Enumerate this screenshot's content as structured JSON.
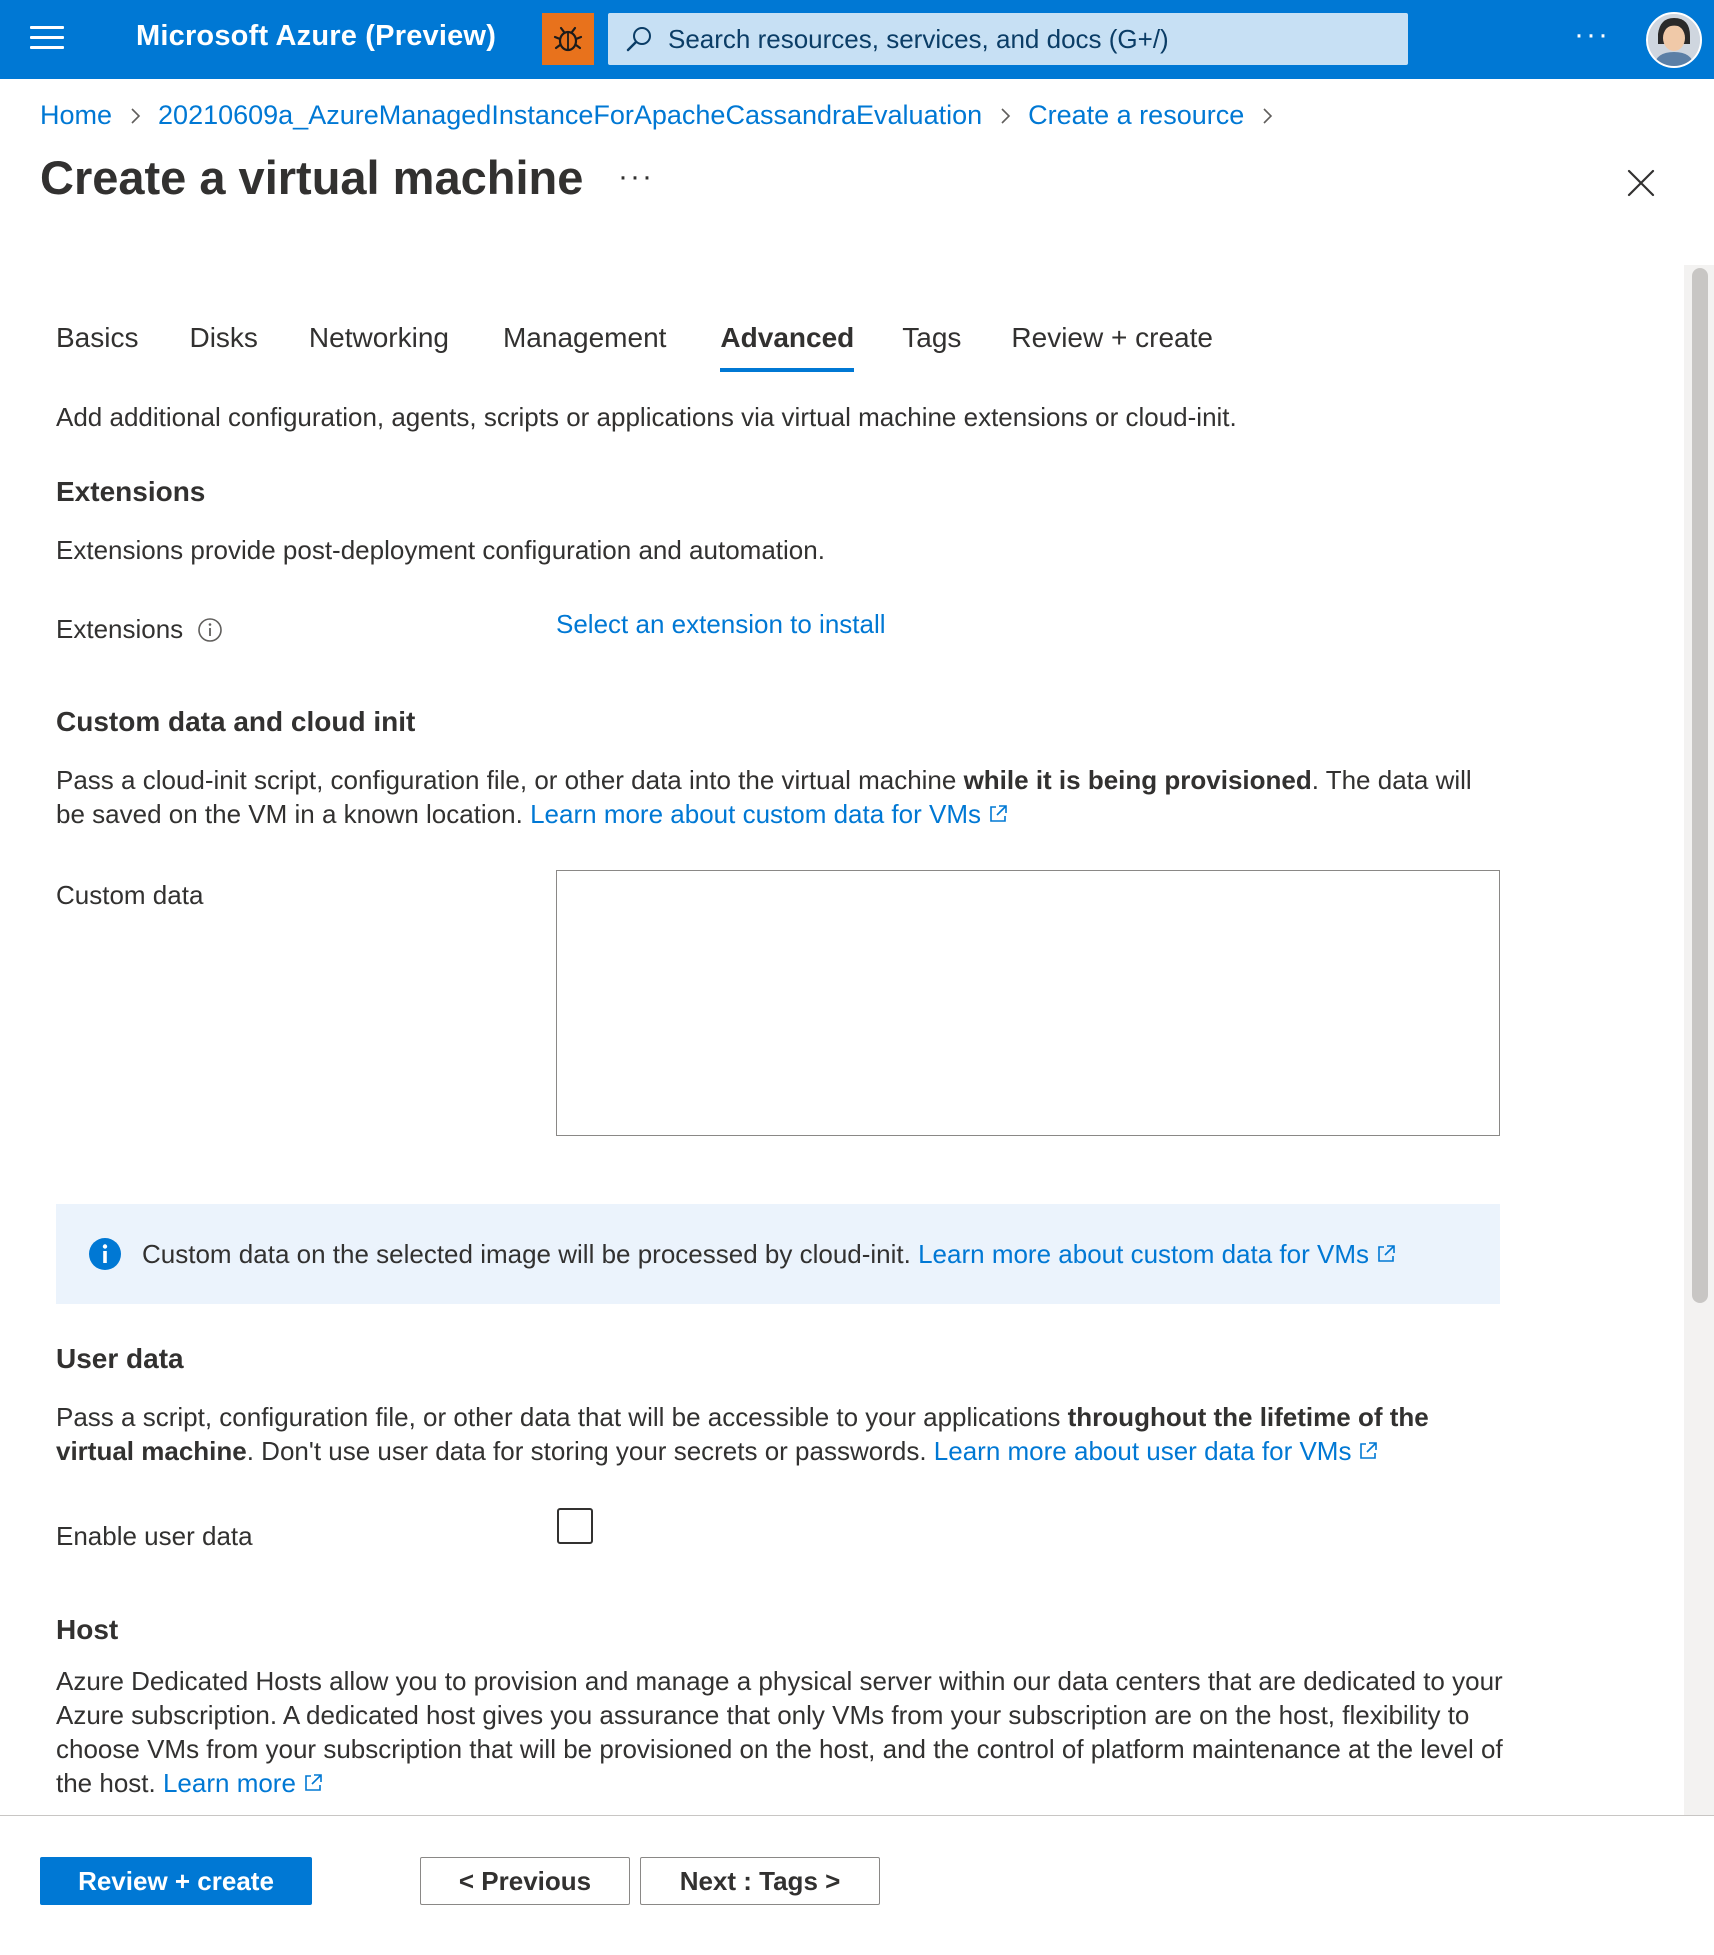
{
  "topbar": {
    "brand": "Microsoft Azure (Preview)",
    "search_placeholder": "Search resources, services, and docs (G+/)",
    "more_label": "···",
    "icons": [
      "hamburger-menu-icon",
      "bug-icon",
      "search-icon",
      "user-avatar"
    ],
    "colors": {
      "bar": "#0078d4",
      "bug_button": "#e8721c",
      "search_bg": "#c7e0f4"
    }
  },
  "breadcrumb": {
    "items": [
      "Home",
      "20210609a_AzureManagedInstanceForApacheCassandraEvaluation",
      "Create a resource"
    ]
  },
  "page": {
    "title": "Create a virtual machine",
    "more_label": "···"
  },
  "tabs": {
    "items": [
      "Basics",
      "Disks",
      "Networking",
      "Management",
      "Advanced",
      "Tags",
      "Review + create"
    ],
    "active": "Advanced"
  },
  "intro": "Add additional configuration, agents, scripts or applications via virtual machine extensions or cloud-init.",
  "extensions": {
    "heading": "Extensions",
    "description": "Extensions provide post-deployment configuration and automation.",
    "field_label": "Extensions",
    "link": "Select an extension to install"
  },
  "custom_data": {
    "heading": "Custom data and cloud init",
    "desc_part1": "Pass a cloud-init script, configuration file, or other data into the virtual machine ",
    "desc_bold": "while it is being provisioned",
    "desc_part2": ". The data will be saved on the VM in a known location.",
    "learn_link": "Learn more about custom data for VMs",
    "field_label": "Custom data",
    "value": ""
  },
  "info_banner": {
    "text": "Custom data on the selected image will be processed by cloud-init.",
    "link": "Learn more about custom data for VMs"
  },
  "user_data": {
    "heading": "User data",
    "desc_part1": "Pass a script, configuration file, or other data that will be accessible to your applications ",
    "desc_bold": "throughout the lifetime of the virtual machine",
    "desc_part2": ". Don't use user data for storing your secrets or passwords.",
    "learn_link": "Learn more about user data for VMs",
    "field_label": "Enable user data",
    "checked": false
  },
  "host": {
    "heading": "Host",
    "description": "Azure Dedicated Hosts allow you to provision and manage a physical server within our data centers that are dedicated to your Azure subscription. A dedicated host gives you assurance that only VMs from your subscription are on the host, flexibility to choose VMs from your subscription that will be provisioned on the host, and the control of platform maintenance at the level of the host.",
    "learn_link": "Learn more"
  },
  "footer": {
    "review_create": "Review + create",
    "previous": "< Previous",
    "next": "Next : Tags >"
  }
}
